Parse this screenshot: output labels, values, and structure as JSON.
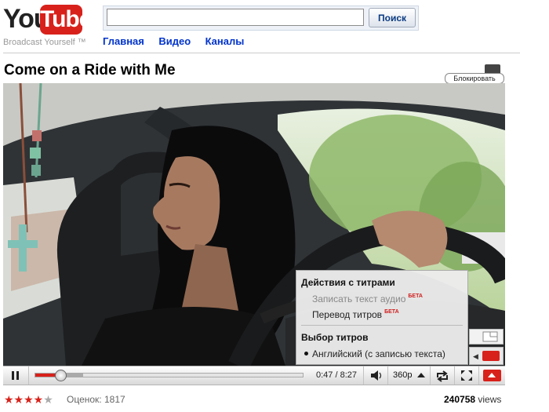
{
  "header": {
    "logo_you": "You",
    "logo_tube": "Tube",
    "tagline": "Broadcast Yourself ™",
    "search": {
      "value": "",
      "placeholder": "",
      "button_label": "Поиск"
    },
    "nav": [
      "Главная",
      "Видео",
      "Каналы"
    ]
  },
  "video": {
    "title": "Come on a Ride with Me",
    "block_label": "Блокировать"
  },
  "captions_menu": {
    "section1_title": "Действия с титрами",
    "items": [
      {
        "label": "Записать текст аудио",
        "badge": "БЕТА",
        "enabled": false
      },
      {
        "label": "Перевод титров",
        "badge": "БЕТА",
        "enabled": true
      }
    ],
    "section2_title": "Выбор титров",
    "selected_track": "Английский (с записью текста)"
  },
  "player": {
    "time_current": "0:47",
    "time_total": "8:27",
    "time_display": "0:47 / 8:27",
    "played_fraction": 0.0927,
    "loaded_fraction": 0.18,
    "quality": "360p",
    "accent_color": "#d8211b"
  },
  "stats": {
    "stars": "★★★★",
    "half_star": "★",
    "rating_text": "Оценок: 1817",
    "view_count": "240758",
    "views_label": "views"
  },
  "icons": [
    "pause-icon",
    "volume-icon",
    "popout-icon",
    "fullscreen-icon",
    "toggle-size-icon",
    "captions-icon"
  ]
}
